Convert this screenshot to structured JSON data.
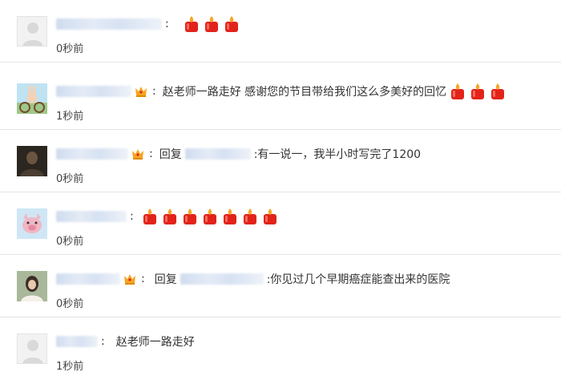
{
  "comments": [
    {
      "text": "",
      "time": "0秒前",
      "candles": 3,
      "reply": false,
      "avatar": "default-avatar"
    },
    {
      "text": "赵老师一路走好 感谢您的节目带给我们这么多美好的回忆",
      "time": "1秒前",
      "candles": 3,
      "reply": false,
      "avatar": "rabbit-bike-avatar"
    },
    {
      "reply_word": "回复",
      "text": ":有一说一，我半小时写完了1200",
      "time": "0秒前",
      "candles": 0,
      "reply": true,
      "avatar": "dark-photo-avatar"
    },
    {
      "text": "",
      "time": "0秒前",
      "candles": 7,
      "reply": false,
      "avatar": "pig-avatar"
    },
    {
      "reply_word": "回复",
      "text": ":你见过几个早期癌症能查出来的医院",
      "time": "0秒前",
      "candles": 0,
      "reply": true,
      "avatar": "woman-photo-avatar"
    },
    {
      "text": "赵老师一路走好",
      "time": "1秒前",
      "candles": 0,
      "reply": false,
      "avatar": "default-avatar"
    }
  ],
  "colon": ":",
  "colors": {
    "divider": "#e5e5e5",
    "text": "#333333",
    "blur": "#d6e1f2",
    "candle_red": "#e2231a",
    "flame": "#f5a623"
  }
}
